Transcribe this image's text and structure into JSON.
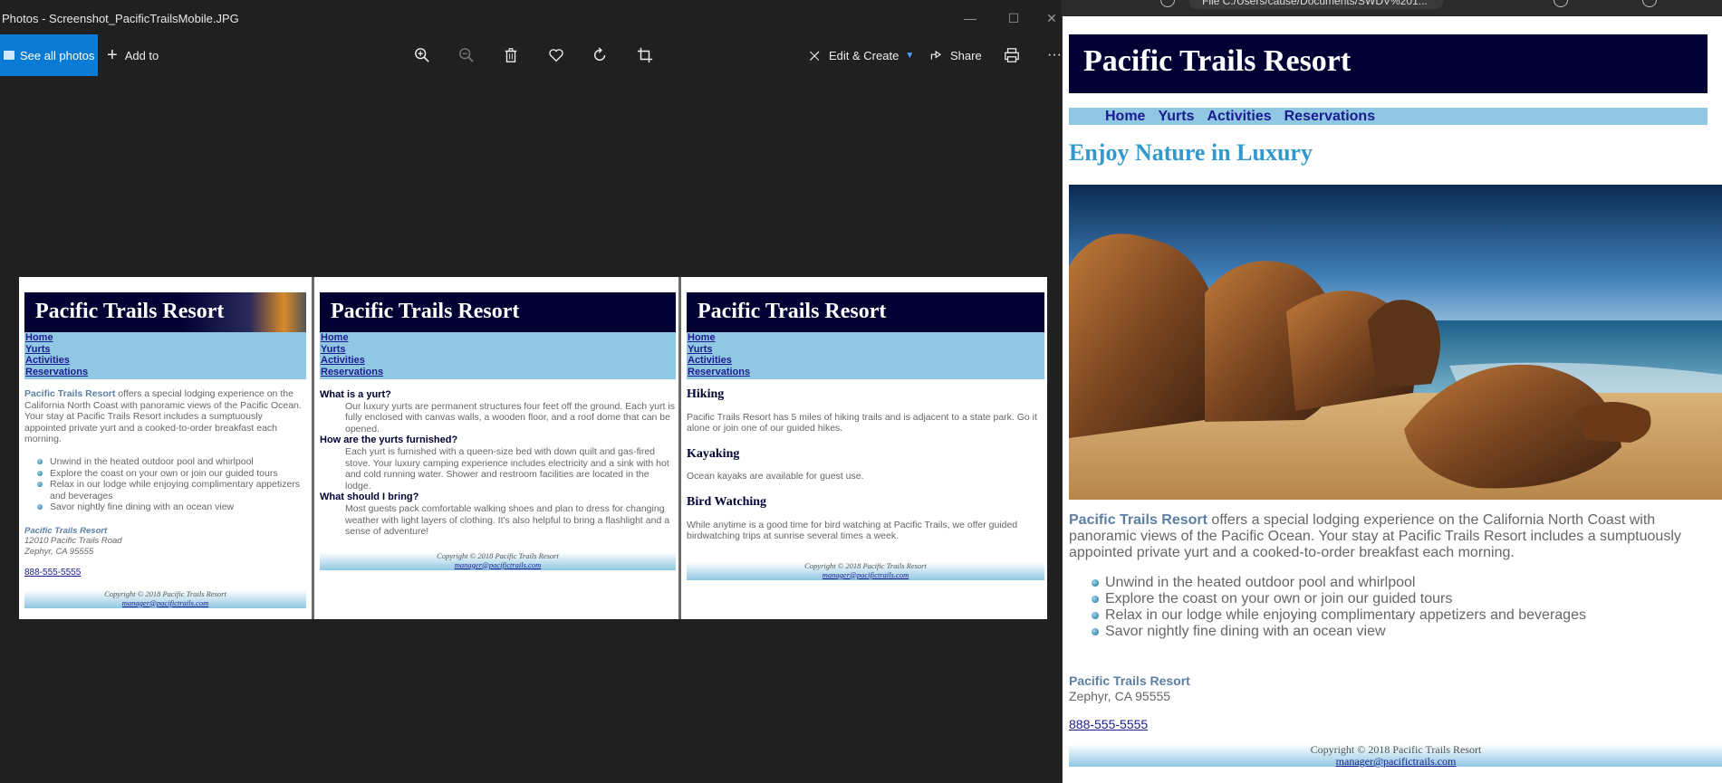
{
  "photos_app": {
    "title": "Photos - Screenshot_PacificTrailsMobile.JPG",
    "window_controls": {
      "minimize": "—",
      "maximize": "☐",
      "close": "✕"
    },
    "toolbar": {
      "see_all_photos": "See all photos",
      "add_to": "Add to",
      "edit_create": "Edit & Create",
      "share": "Share",
      "more": "···",
      "icons": [
        "zoom-in-icon",
        "zoom-out-icon",
        "delete-icon",
        "heart-icon",
        "rotate-icon",
        "crop-icon",
        "print-icon"
      ]
    }
  },
  "mobile_pages": {
    "header": "Pacific Trails Resort",
    "nav": [
      "Home",
      "Yurts",
      "Activities",
      "Reservations"
    ],
    "home": {
      "brand": "Pacific Trails Resort",
      "intro": " offers a special lodging experience on the California North Coast with panoramic views of the Pacific Ocean. Your stay at Pacific Trails Resort includes a sumptuously appointed private yurt and a cooked-to-order breakfast each morning.",
      "bullets": [
        "Unwind in the heated outdoor pool and whirlpool",
        "Explore the coast on your own or join our guided tours",
        "Relax in our lodge while enjoying complimentary appetizers and beverages",
        "Savor nightly fine dining with an ocean view"
      ],
      "address_name": "Pacific Trails Resort",
      "address_line1": "12010 Pacific Trails Road",
      "address_line2": "Zephyr, CA 95555",
      "phone": "888-555-5555"
    },
    "yurts": {
      "qa": [
        {
          "q": "What is a yurt?",
          "a": "Our luxury yurts are permanent structures four feet off the ground. Each yurt is fully enclosed with canvas walls, a wooden floor, and a roof dome that can be opened."
        },
        {
          "q": "How are the yurts furnished?",
          "a": "Each yurt is furnished with a queen-size bed with down quilt and gas-fired stove. Your luxury camping experience includes electricity and a sink with hot and cold running water. Shower and restroom facilities are located in the lodge."
        },
        {
          "q": "What should I bring?",
          "a": "Most guests pack comfortable walking shoes and plan to dress for changing weather with light layers of clothing. It's also helpful to bring a flashlight and a sense of adventure!"
        }
      ]
    },
    "activities": {
      "items": [
        {
          "title": "Hiking",
          "text": "Pacific Trails Resort has 5 miles of hiking trails and is adjacent to a state park. Go it alone or join one of our guided hikes."
        },
        {
          "title": "Kayaking",
          "text": "Ocean kayaks are available for guest use."
        },
        {
          "title": "Bird Watching",
          "text": "While anytime is a good time for bird watching at Pacific Trails, we offer guided birdwatching trips at sunrise several times a week."
        }
      ]
    },
    "footer": {
      "copyright": "Copyright © 2018 Pacific Trails Resort",
      "email": "manager@pacifictrails.com"
    }
  },
  "browser": {
    "url": "File   C:/Users/cause/Documents/SWDV%201...",
    "header": "Pacific Trails Resort",
    "nav": [
      "Home",
      "Yurts",
      "Activities",
      "Reservations"
    ],
    "heading": "Enjoy Nature in Luxury",
    "brand": "Pacific Trails Resort",
    "intro": " offers a special lodging experience on the California North Coast with panoramic views of the Pacific Ocean. Your stay at Pacific Trails Resort includes a sumptuously appointed private yurt and a cooked-to-order breakfast each morning.",
    "bullets": [
      "Unwind in the heated outdoor pool and whirlpool",
      "Explore the coast on your own or join our guided tours",
      "Relax in our lodge while enjoying complimentary appetizers and beverages",
      "Savor nightly fine dining with an ocean view"
    ],
    "contact_name": "Pacific Trails Resort",
    "contact_city": "Zephyr, CA 95555",
    "phone": "888-555-5555",
    "footer": {
      "copyright": "Copyright © 2018 Pacific Trails Resort",
      "email": "manager@pacifictrails.com"
    }
  },
  "colors": {
    "accent": "#0a7bd5",
    "navy": "#000033",
    "nav_blue": "#90c7e3",
    "heading_blue": "#3399cc"
  }
}
